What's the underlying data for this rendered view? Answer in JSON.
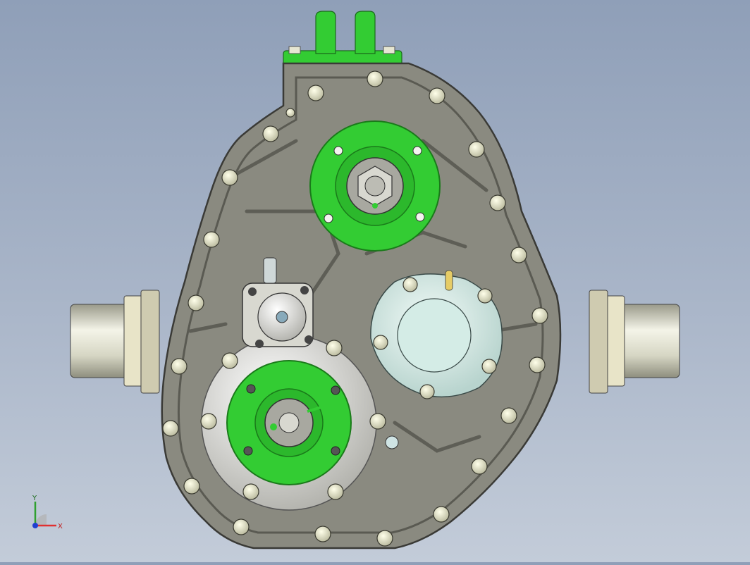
{
  "viewport": {
    "background_top": "#8f9fb8",
    "background_bottom": "#c3ccd9"
  },
  "model": {
    "housing_color": "#8a8a80",
    "housing_edge_color": "#3a3a36",
    "highlight_color": "#33cc33",
    "shaft_color": "#d8d8c8",
    "cover_color": "#d6ede8"
  },
  "axis_triad": {
    "x_label": "X",
    "y_label": "Y",
    "x_color": "#e03030",
    "y_color": "#30a030",
    "z_color": "#2040d0"
  }
}
